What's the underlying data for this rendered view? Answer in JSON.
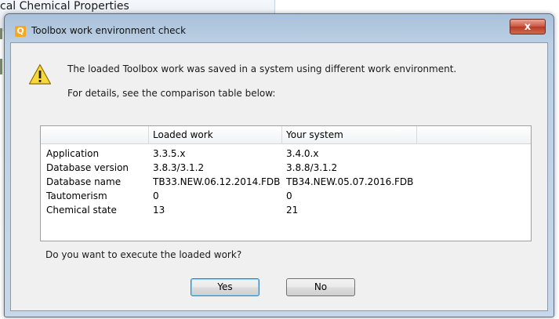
{
  "background_window": {
    "title": "cal Chemical Properties"
  },
  "dialog": {
    "title": "Toolbox work environment check",
    "close_glyph": "x",
    "app_icon_glyph": "Q",
    "message_line1": "The loaded Toolbox work was saved in a system using different work environment.",
    "message_line2": "For details, see the comparison table below:",
    "table": {
      "headers": [
        "",
        "Loaded work",
        "Your system"
      ],
      "rows": [
        [
          "Application",
          "3.3.5.x",
          "3.4.0.x"
        ],
        [
          "Database version",
          "3.8.3/3.1.2",
          "3.8.8/3.1.2"
        ],
        [
          "Database name",
          "TB33.NEW.06.12.2014.FDB",
          "TB34.NEW.05.07.2016.FDB"
        ],
        [
          "Tautomerism",
          "0",
          "0"
        ],
        [
          "Chemical state",
          "13",
          "21"
        ]
      ]
    },
    "question": "Do you want to execute the loaded work?",
    "buttons": {
      "yes": "Yes",
      "no": "No"
    },
    "icons": {
      "warning": "warning-icon",
      "app": "toolbox-icon",
      "close": "close-icon"
    },
    "colors": {
      "close_button": "#c8553f",
      "app_icon": "#f5a623",
      "warning": "#f7d83a",
      "default_button_border": "#3c7fb1"
    }
  }
}
